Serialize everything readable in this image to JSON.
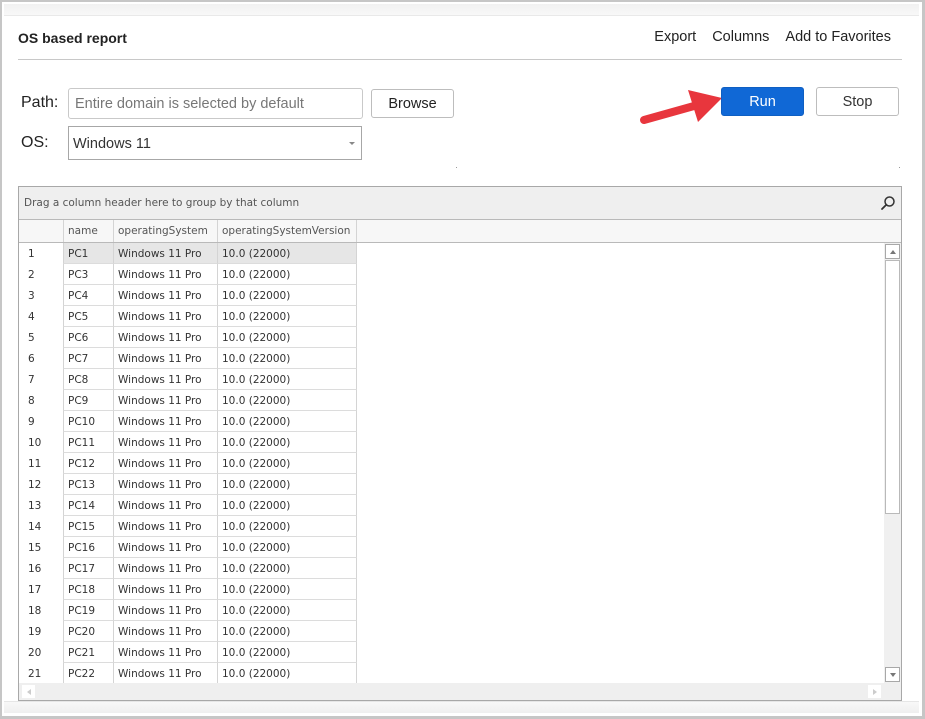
{
  "report": {
    "title": "OS based report",
    "links": [
      "Export",
      "Columns",
      "Add to Favorites"
    ]
  },
  "form": {
    "path_label": "Path:",
    "path_value": "",
    "path_placeholder": "Entire domain is selected by default",
    "browse_label": "Browse",
    "os_label": "OS:",
    "os_selected": "Windows 11",
    "run_label": "Run",
    "stop_label": "Stop"
  },
  "colors": {
    "run_button": "#1068d6",
    "annotation_arrow": "#e8363d"
  },
  "grid": {
    "group_panel_text": "Drag a column header here to group by that column",
    "columns": [
      "name",
      "operatingSystem",
      "operatingSystemVersion"
    ],
    "selected_row": 1,
    "rows": [
      {
        "n": "1",
        "name": "PC1",
        "os": "Windows 11 Pro",
        "ver": "10.0 (22000)"
      },
      {
        "n": "2",
        "name": "PC3",
        "os": "Windows 11 Pro",
        "ver": "10.0 (22000)"
      },
      {
        "n": "3",
        "name": "PC4",
        "os": "Windows 11 Pro",
        "ver": "10.0 (22000)"
      },
      {
        "n": "4",
        "name": "PC5",
        "os": "Windows 11 Pro",
        "ver": "10.0 (22000)"
      },
      {
        "n": "5",
        "name": "PC6",
        "os": "Windows 11 Pro",
        "ver": "10.0 (22000)"
      },
      {
        "n": "6",
        "name": "PC7",
        "os": "Windows 11 Pro",
        "ver": "10.0 (22000)"
      },
      {
        "n": "7",
        "name": "PC8",
        "os": "Windows 11 Pro",
        "ver": "10.0 (22000)"
      },
      {
        "n": "8",
        "name": "PC9",
        "os": "Windows 11 Pro",
        "ver": "10.0 (22000)"
      },
      {
        "n": "9",
        "name": "PC10",
        "os": "Windows 11 Pro",
        "ver": "10.0 (22000)"
      },
      {
        "n": "10",
        "name": "PC11",
        "os": "Windows 11 Pro",
        "ver": "10.0 (22000)"
      },
      {
        "n": "11",
        "name": "PC12",
        "os": "Windows 11 Pro",
        "ver": "10.0 (22000)"
      },
      {
        "n": "12",
        "name": "PC13",
        "os": "Windows 11 Pro",
        "ver": "10.0 (22000)"
      },
      {
        "n": "13",
        "name": "PC14",
        "os": "Windows 11 Pro",
        "ver": "10.0 (22000)"
      },
      {
        "n": "14",
        "name": "PC15",
        "os": "Windows 11 Pro",
        "ver": "10.0 (22000)"
      },
      {
        "n": "15",
        "name": "PC16",
        "os": "Windows 11 Pro",
        "ver": "10.0 (22000)"
      },
      {
        "n": "16",
        "name": "PC17",
        "os": "Windows 11 Pro",
        "ver": "10.0 (22000)"
      },
      {
        "n": "17",
        "name": "PC18",
        "os": "Windows 11 Pro",
        "ver": "10.0 (22000)"
      },
      {
        "n": "18",
        "name": "PC19",
        "os": "Windows 11 Pro",
        "ver": "10.0 (22000)"
      },
      {
        "n": "19",
        "name": "PC20",
        "os": "Windows 11 Pro",
        "ver": "10.0 (22000)"
      },
      {
        "n": "20",
        "name": "PC21",
        "os": "Windows 11 Pro",
        "ver": "10.0 (22000)"
      },
      {
        "n": "21",
        "name": "PC22",
        "os": "Windows 11 Pro",
        "ver": "10.0 (22000)"
      }
    ]
  },
  "icons": {
    "search": "search-icon",
    "dropdown": "chevron-down-icon",
    "scroll_up": "arrow-up-icon",
    "scroll_down": "arrow-down-icon",
    "scroll_left": "arrow-left-icon",
    "scroll_right": "arrow-right-icon",
    "annotation": "red-arrow-icon"
  }
}
